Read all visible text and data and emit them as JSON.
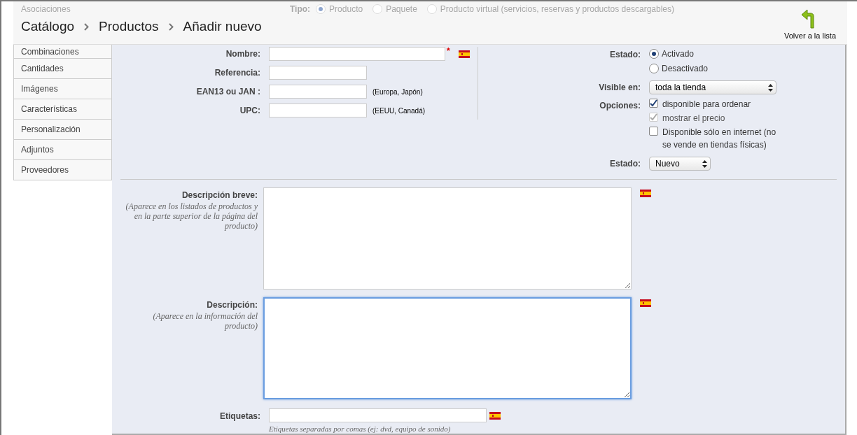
{
  "header": {
    "breadcrumb": [
      "Catálogo",
      "Productos",
      "Añadir nuevo"
    ],
    "back_button": "Volver a la lista"
  },
  "type": {
    "label": "Tipo:",
    "options": [
      {
        "label": "Producto",
        "selected": true
      },
      {
        "label": "Paquete",
        "selected": false
      },
      {
        "label": "Producto virtual (servicios, reservas y productos descargables)",
        "selected": false
      }
    ]
  },
  "sidebar": {
    "items": [
      {
        "label": "Asociaciones"
      },
      {
        "label": "Combinaciones"
      },
      {
        "label": "Cantidades"
      },
      {
        "label": "Imágenes"
      },
      {
        "label": "Características"
      },
      {
        "label": "Personalización"
      },
      {
        "label": "Adjuntos"
      },
      {
        "label": "Proveedores"
      }
    ]
  },
  "fields": [
    {
      "label": "Nombre:",
      "wide": true,
      "marker": "*",
      "translatable": true
    },
    {
      "label": "Referencia:",
      "wide": false,
      "translatable": false
    },
    {
      "label": "EAN13 ou JAN :",
      "wide": false,
      "note": "(Europa, Japón)",
      "translatable": false
    },
    {
      "label": "UPC:",
      "wide": false,
      "note": "(EEUU, Canadá)",
      "translatable": false
    }
  ],
  "status": {
    "label": "Estado:",
    "options": [
      {
        "label": "Activado",
        "selected": true
      },
      {
        "label": "Desactivado",
        "selected": false
      }
    ]
  },
  "visibility": {
    "label": "Visible en:",
    "value": "toda la tienda"
  },
  "options": {
    "label": "Opciones:",
    "items": [
      {
        "label": "disponible para ordenar",
        "checked": true,
        "disabled": false
      },
      {
        "label": "mostrar el precio",
        "checked": true,
        "disabled": true
      },
      {
        "label": "Disponible sólo en internet (no se vende en tiendas físicas)",
        "checked": false,
        "disabled": false
      }
    ]
  },
  "condition": {
    "label": "Estado:",
    "value": "Nuevo"
  },
  "descriptions": [
    {
      "label": "Descripción breve:",
      "hint": "(Aparece en los listados de productos y en la parte superior de la página del producto)",
      "focused": false
    },
    {
      "label": "Descripción:",
      "hint": "(Aparece en la información del producto)",
      "focused": true
    }
  ],
  "tags": {
    "label": "Etiquetas:",
    "hint": "Etiquetas separadas por comas (ej: dvd, equipo de sonido)"
  }
}
